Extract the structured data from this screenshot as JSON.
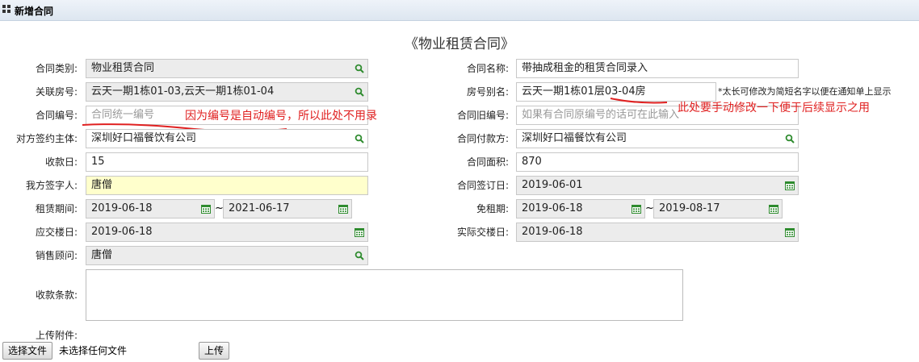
{
  "window": {
    "title": "新增合同"
  },
  "doc_title": "《物业租赁合同》",
  "fields": {
    "contract_type": {
      "label": "合同类别:",
      "value": "物业租赁合同"
    },
    "contract_name": {
      "label": "合同名称:",
      "value": "带抽成租金的租赁合同录入"
    },
    "related_room": {
      "label": "关联房号:",
      "value": "云天一期1栋01-03,云天一期1栋01-04"
    },
    "room_alias": {
      "label": "房号别名:",
      "value": "云天一期1栋01层03-04房",
      "note": "*太长可修改为简短名字以便在通知单上显示"
    },
    "contract_no": {
      "label": "合同编号:",
      "placeholder": "合同统一编号"
    },
    "old_contract_no": {
      "label": "合同旧编号:",
      "placeholder": "如果有合同原编号的话可在此输入"
    },
    "counterparty": {
      "label": "对方签约主体:",
      "value": "深圳好口福餐饮有公司"
    },
    "payer": {
      "label": "合同付款方:",
      "value": "深圳好口福餐饮有公司"
    },
    "collection_day": {
      "label": "收款日:",
      "value": "15"
    },
    "contract_area": {
      "label": "合同面积:",
      "value": "870"
    },
    "our_signer": {
      "label": "我方签字人:",
      "value": "唐僧"
    },
    "sign_date": {
      "label": "合同签订日:",
      "value": "2019-06-01"
    },
    "lease_period": {
      "label": "租赁期间:",
      "start": "2019-06-18",
      "end": "2021-06-17",
      "sep": "~"
    },
    "free_period": {
      "label": "免租期:",
      "start": "2019-06-18",
      "end": "2019-08-17",
      "sep": "~"
    },
    "handover_due": {
      "label": "应交楼日:",
      "value": "2019-06-18"
    },
    "handover_actual": {
      "label": "实际交楼日:",
      "value": "2019-06-18"
    },
    "sales_advisor": {
      "label": "销售顾问:",
      "value": "唐僧"
    },
    "payment_terms": {
      "label": "收款条款:",
      "value": ""
    },
    "attachment": {
      "label": "上传附件:",
      "choose_label": "选择文件",
      "no_file_text": "未选择任何文件",
      "upload_label": "上传"
    }
  },
  "annotations": {
    "contract_no_note": "因为编号是自动编号，所以此处不用录",
    "alias_note": "此处要手动修改一下便于后续显示之用",
    "color": "#e02020"
  },
  "icons": {
    "lookup": "search-icon",
    "date": "calendar-icon"
  }
}
